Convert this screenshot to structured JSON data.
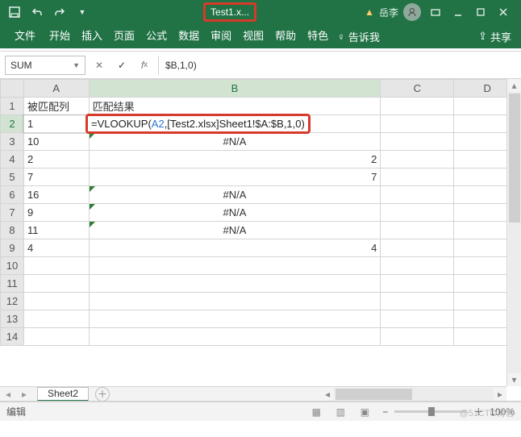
{
  "titlebar": {
    "filename": "Test1.x...",
    "username": "岳李"
  },
  "ribbon": {
    "file": "文件",
    "home": "开始",
    "insert": "插入",
    "page": "页面",
    "formulas": "公式",
    "data": "数据",
    "review": "审阅",
    "view": "视图",
    "help": "帮助",
    "special": "特色",
    "tell": "告诉我",
    "share": "共享"
  },
  "namebox": {
    "ref": "SUM"
  },
  "formula_bar": {
    "text": "$B,1,0)"
  },
  "columns": {
    "a": "A",
    "b": "B",
    "c": "C",
    "d": "D"
  },
  "headers": {
    "a": "被匹配列",
    "b": "匹配结果"
  },
  "formula_overlay": {
    "pre": "=VLOOKUP(",
    "ref": "A2",
    "post": ",[Test2.xlsx]Sheet1!$A:$B,1,0)"
  },
  "cells": {
    "a2": "1",
    "a3": "10",
    "a4": "2",
    "a5": "7",
    "a6": "16",
    "a7": "9",
    "a8": "11",
    "a9": "4",
    "b3": "#N/A",
    "b4": "2",
    "b5": "7",
    "b6": "#N/A",
    "b7": "#N/A",
    "b8": "#N/A",
    "b9": "4"
  },
  "rownums": [
    "1",
    "2",
    "3",
    "4",
    "5",
    "6",
    "7",
    "8",
    "9",
    "10",
    "11",
    "12",
    "13",
    "14"
  ],
  "sheet_tab": "Sheet2",
  "statusbar": {
    "mode": "编辑",
    "zoom": "100%"
  },
  "watermark": "@51CTO博客"
}
